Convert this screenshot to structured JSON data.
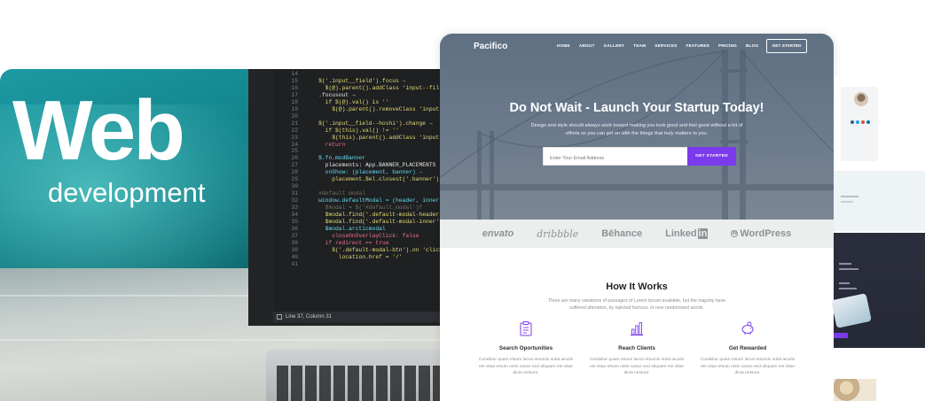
{
  "banner": {
    "headline": "Web",
    "subheadline": "development"
  },
  "code_editor": {
    "lines": [
      {
        "n": "14",
        "t": ""
      },
      {
        "n": "15",
        "t": "    $('.input__field').focus →"
      },
      {
        "n": "16",
        "t": "      $(@).parent().addClass 'input--filled'"
      },
      {
        "n": "17",
        "t": "    .focusout →"
      },
      {
        "n": "18",
        "t": "      if $(@).val() is ''"
      },
      {
        "n": "19",
        "t": "        $(@).parent().removeClass 'input--filled"
      },
      {
        "n": "20",
        "t": ""
      },
      {
        "n": "21",
        "t": "    $('.input__field--hoshi').change →"
      },
      {
        "n": "22",
        "t": "      if $(this).val() != ''"
      },
      {
        "n": "23",
        "t": "        $(this).parent().addClass 'input--filled"
      },
      {
        "n": "24",
        "t": "      return"
      },
      {
        "n": "25",
        "t": ""
      },
      {
        "n": "26",
        "t": "    $.fn.modBanner"
      },
      {
        "n": "27",
        "t": "      placements: App.BANNER_PLACEMENTS"
      },
      {
        "n": "28",
        "t": "      onShow: (placement, banner) →"
      },
      {
        "n": "29",
        "t": "        placement.$el.closest('.banner').show()"
      },
      {
        "n": "30",
        "t": ""
      },
      {
        "n": "31",
        "t": "    #default modal"
      },
      {
        "n": "32",
        "t": "    window.defaultModal = (header, inner, redirect"
      },
      {
        "n": "33",
        "t": "      $modal = $('#default_modal')f"
      },
      {
        "n": "34",
        "t": "      $modal.find('.default-modal-header').text he"
      },
      {
        "n": "35",
        "t": "      $modal.find('.default-modal-inner').html inn"
      },
      {
        "n": "36",
        "t": "      $modal.arcticmodal"
      },
      {
        "n": "37",
        "t": "        closeOnOverlayClick: false"
      },
      {
        "n": "38",
        "t": "      if redirect == true"
      },
      {
        "n": "39",
        "t": "        $('.default-modal-btn').on 'click', →"
      },
      {
        "n": "40",
        "t": "          location.href = '/'"
      },
      {
        "n": "41",
        "t": ""
      }
    ],
    "status": "Line 37, Column 31"
  },
  "site": {
    "brand": "Pacifico",
    "nav": [
      "HOME",
      "ABOUT",
      "GALLERY",
      "TEAM",
      "SERVICES",
      "FEATURES",
      "PRICING",
      "BLOG"
    ],
    "nav_cta": "GET STARTED",
    "hero_title": "Do Not Wait - Launch Your Startup Today!",
    "hero_sub": "Design and style should always work toward making you look good and feel good without a lot of efforts so you can get on with the things that truly matters to you.",
    "email_placeholder": "Enter Your Email Address",
    "email_button": "GET STARTED",
    "logos": {
      "envato": "envato",
      "dribbble": "dribbble",
      "behance": "Bēhance",
      "linkedin": "Linked",
      "linkedin_box": "in",
      "wordpress": "WordPress"
    },
    "how": {
      "title": "How It Works",
      "desc": "There are many variations of passages of Lorem Ipsum available, but the majority have suffered alteration, by injected humour, or new randomised words.",
      "features": [
        {
          "title": "Search Oportunities",
          "icon": "clipboard-icon",
          "desc": "Curabitur quam etsum lacus etsumis nulat iaculis ets vitae etsum nisle varius sed aliquam ets vitae dicta netsum."
        },
        {
          "title": "Reach Clients",
          "icon": "bar-chart-icon",
          "desc": "Curabitur quam etsum lacus etsumis nulat iaculis ets vitae etsum nisle varius sed aliquam ets vitae dicta netsum."
        },
        {
          "title": "Get Rewarded",
          "icon": "piggy-bank-icon",
          "desc": "Curabitur quam etsum lacus etsumis nulat iaculis ets vitae etsum nisle varius sed aliquam ets vitae dicta netsum."
        }
      ]
    }
  },
  "colors": {
    "accent": "#7c3aed",
    "hero": "#64758a",
    "teal": "#118a91"
  }
}
